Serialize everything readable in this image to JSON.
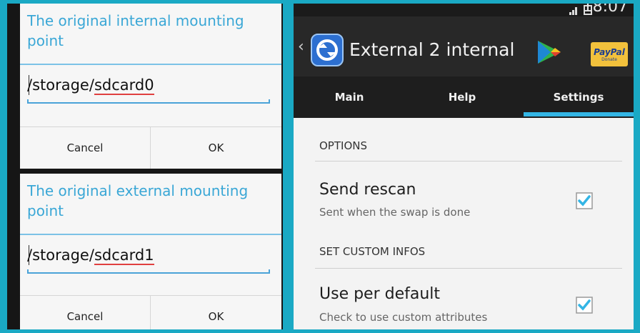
{
  "left_dialogs": [
    {
      "title": "The original internal mounting point",
      "value_prefix": "/storage/",
      "value_underlined": "sdcard0",
      "buttons": {
        "cancel": "Cancel",
        "ok": "OK"
      }
    },
    {
      "title": "The original external mounting point",
      "value_prefix": "/storage/",
      "value_underlined": "sdcard1",
      "buttons": {
        "cancel": "Cancel",
        "ok": "OK"
      }
    }
  ],
  "status_bar": {
    "time": "18:07"
  },
  "action_bar": {
    "title": "External 2 internal",
    "paypal_label": "PayPal",
    "paypal_sub": "Donate"
  },
  "tabs": [
    {
      "label": "Main"
    },
    {
      "label": "Help"
    },
    {
      "label": "Settings",
      "selected": true
    }
  ],
  "settings": {
    "options_header": "OPTIONS",
    "send_rescan": {
      "title": "Send rescan",
      "summary": "Sent when the swap is done",
      "checked": true
    },
    "custom_header": "SET CUSTOM INFOS",
    "use_per_default": {
      "title": "Use per default",
      "summary": "Check to use custom attributes",
      "checked": true
    }
  },
  "colors": {
    "accent": "#33b5e5",
    "frame": "#1aa9c4",
    "action_bar": "#282828"
  }
}
